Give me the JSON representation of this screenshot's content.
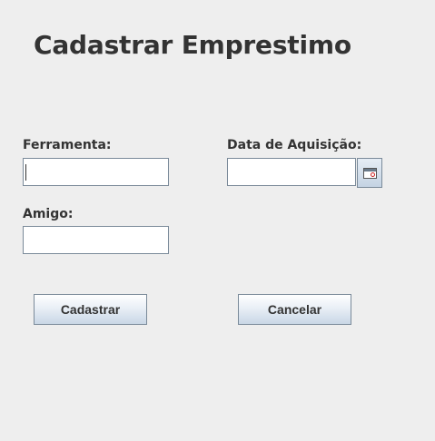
{
  "window": {
    "title": "Cadastrar Emprestimo"
  },
  "form": {
    "ferramenta": {
      "label": "Ferramenta:",
      "value": ""
    },
    "data_aquisicao": {
      "label": "Data de Aquisição:",
      "value": "",
      "picker_icon": "calendar-icon"
    },
    "amigo": {
      "label": "Amigo:",
      "value": ""
    }
  },
  "buttons": {
    "cadastrar": "Cadastrar",
    "cancelar": "Cancelar"
  },
  "colors": {
    "background": "#eeeeee",
    "text": "#333333",
    "border": "#7a8a99",
    "button_gradient_bottom": "#c9d7e6"
  }
}
